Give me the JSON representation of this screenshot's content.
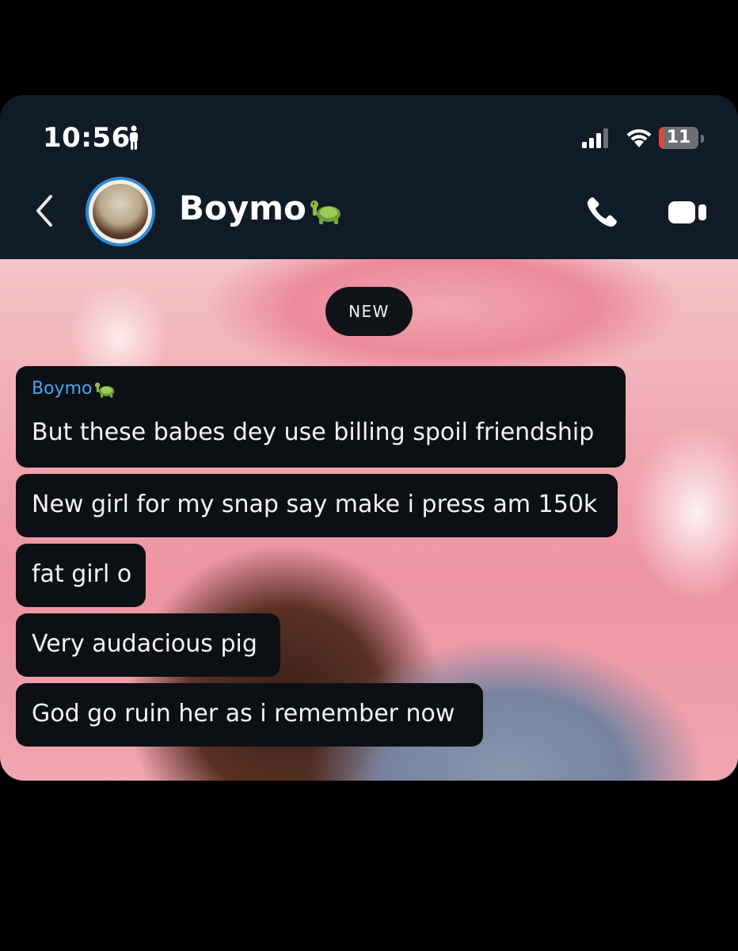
{
  "status_bar": {
    "time": "10:56",
    "battery": "11",
    "battery_level_percent": 11
  },
  "header": {
    "contact_name": "Boymo",
    "contact_emoji": "turtle-icon",
    "accent_color": "#2e8bd6"
  },
  "chat": {
    "new_label": "NEW",
    "sender_name": "Boymo",
    "messages": [
      "But these babes dey use billing spoil friendship",
      "New girl for my snap say make i press am 150k",
      "fat girl o",
      "Very audacious pig",
      "God go ruin her as i remember now"
    ]
  },
  "icons": {
    "back": "chevron-left-icon",
    "call": "phone-icon",
    "video": "video-camera-icon"
  }
}
